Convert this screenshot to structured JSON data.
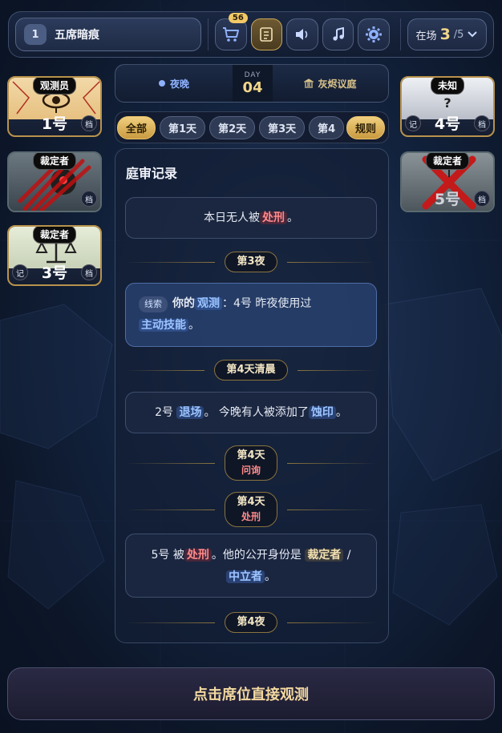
{
  "topbar": {
    "seat_number": "1",
    "seat_name": "五席暗痕",
    "cart_badge": "56",
    "present_label": "在场",
    "present_count": "3",
    "present_total": "/5"
  },
  "seats": {
    "left": [
      {
        "role": "观测员",
        "num": "1号",
        "dang": "档"
      },
      {
        "role": "裁定者",
        "num": "",
        "dang": "档"
      },
      {
        "role": "裁定者",
        "num": "3号",
        "ji": "记",
        "dang": "档"
      }
    ],
    "right": [
      {
        "role": "未知",
        "art_text": "?",
        "num": "4号",
        "ji": "记",
        "dang": "档"
      },
      {
        "role": "裁定者",
        "num": "5号",
        "dang": "档"
      }
    ]
  },
  "phase": {
    "period": "夜晚",
    "day_label": "DAY",
    "day_value": "04",
    "location": "灰烬议庭"
  },
  "tabs": [
    "全部",
    "第1天",
    "第2天",
    "第3天",
    "第4"
  ],
  "rule_tab": "规则",
  "log": {
    "title": "庭审记录",
    "entries": {
      "e1_pre": "本日无人被",
      "e1_hl": "处刑",
      "e1_post": "。",
      "night3": "第3夜",
      "clue_tag": "线索",
      "clue_a": "你的",
      "clue_hl1": "观测",
      "clue_b": "：4号 昨夜使用过",
      "clue_hl2": "主动技能",
      "clue_c": "。",
      "morning4": "第4天清晨",
      "e2_a": "2号",
      "e2_hl1": "退场",
      "e2_b": "。 今晚有人被添加了",
      "e2_hl2": "蚀印",
      "e2_c": "。",
      "day4": "第4天",
      "inquiry": "问询",
      "exec": "处刑",
      "e3_a": "5号 被",
      "e3_hl1": "处刑",
      "e3_b": "。他的公开身份是",
      "e3_hl2": "裁定者",
      "e3_slash": "/",
      "e3_hl3": "中立者",
      "e3_c": "。",
      "night4": "第4夜"
    }
  },
  "bottom_button": "点击席位直接观测"
}
